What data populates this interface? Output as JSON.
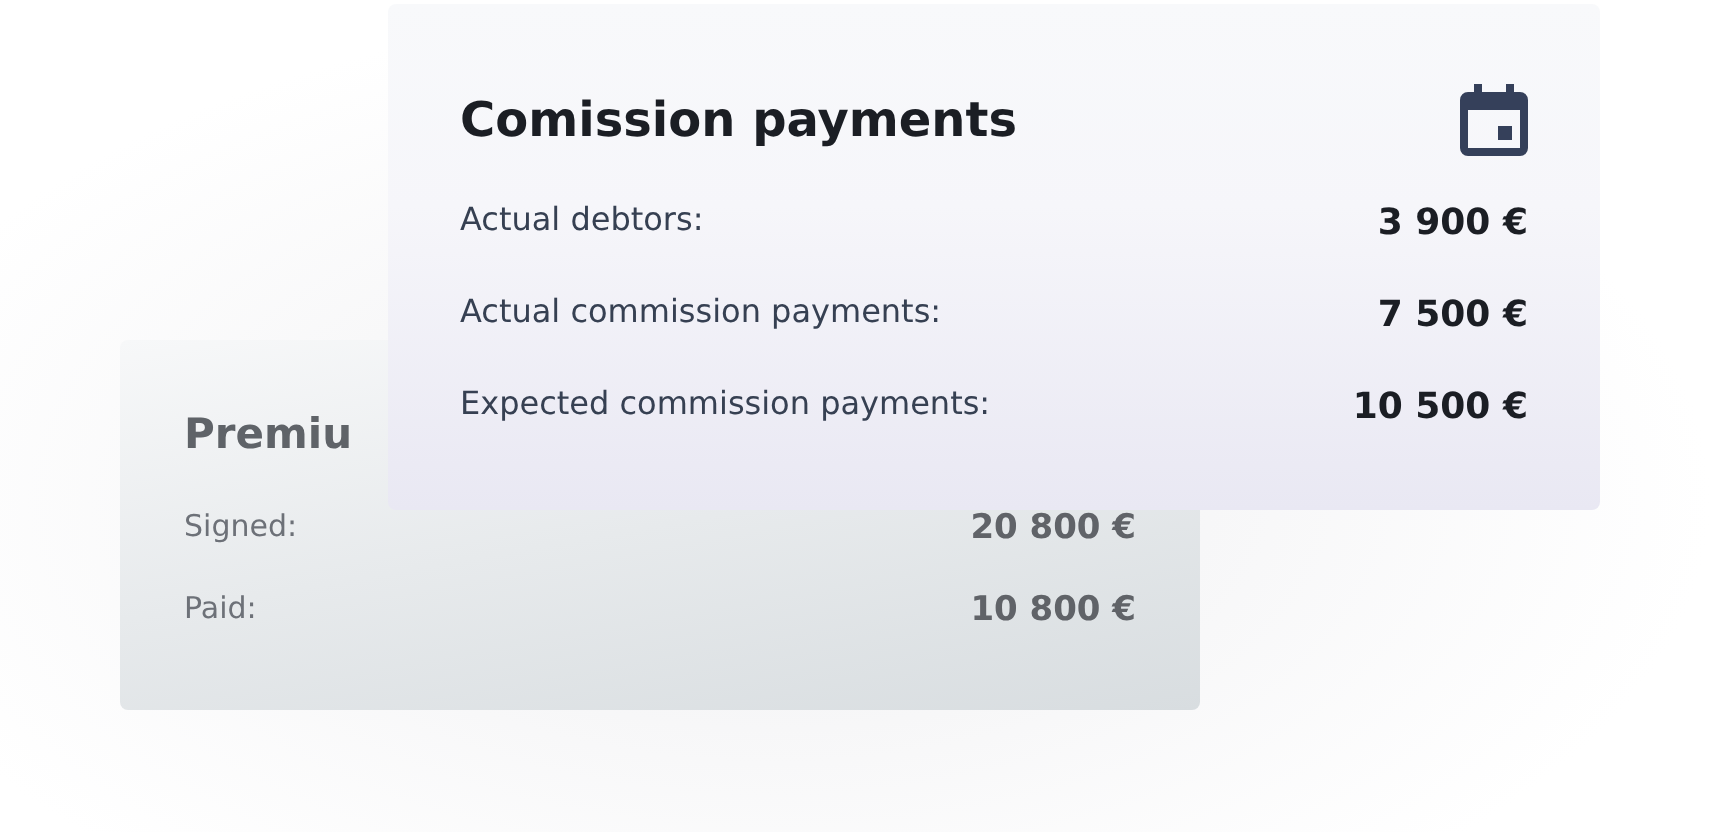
{
  "back_card": {
    "title": "Premiu",
    "rows": [
      {
        "label": "Signed:",
        "value": "20 800 €"
      },
      {
        "label": "Paid:",
        "value": "10 800 €"
      }
    ]
  },
  "front_card": {
    "title": "Comission payments",
    "rows": [
      {
        "label": "Actual debtors:",
        "value": "3 900 €"
      },
      {
        "label": "Actual commission payments:",
        "value": "7 500 €"
      },
      {
        "label": "Expected commission payments:",
        "value": "10 500 €"
      }
    ]
  }
}
